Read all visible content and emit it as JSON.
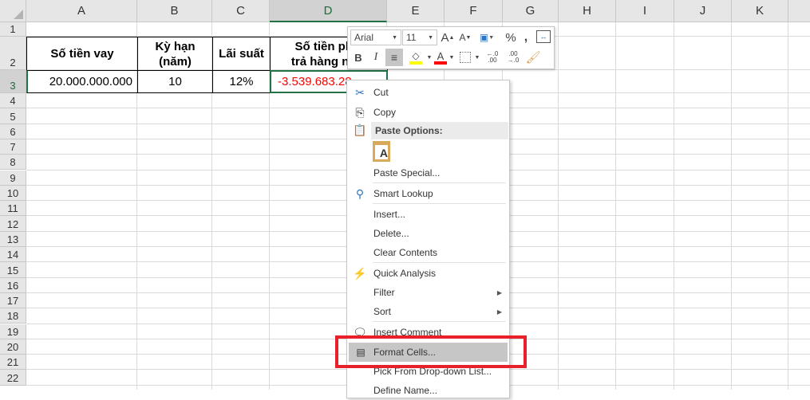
{
  "columns": [
    "A",
    "B",
    "C",
    "D",
    "E",
    "F",
    "G",
    "H",
    "I",
    "J",
    "K"
  ],
  "rows": [
    "1",
    "2",
    "3",
    "4",
    "5",
    "6",
    "7",
    "8",
    "9",
    "10",
    "11",
    "12",
    "13",
    "14",
    "15",
    "16",
    "17",
    "18",
    "19",
    "20",
    "21",
    "22"
  ],
  "headers": {
    "a": "Số tiền vay",
    "b": "Kỳ hạn (năm)",
    "c": "Lãi suất",
    "d": "Số tiền phải trả hàng năm"
  },
  "values": {
    "a": "20.000.000.000",
    "b": "10",
    "c": "12%",
    "d": "-3.539.683.28"
  },
  "toolbar": {
    "font": "Arial",
    "size": "11",
    "bold": "B",
    "italic": "I",
    "percent": "%",
    "comma": ",",
    "inc_dec": "←.0 .00",
    "dec_dec": ".00 →.0"
  },
  "menu": {
    "cut": "Cut",
    "copy": "Copy",
    "paste_options": "Paste Options:",
    "paste_special": "Paste Special...",
    "smart_lookup": "Smart Lookup",
    "insert": "Insert...",
    "delete": "Delete...",
    "clear": "Clear Contents",
    "quick_analysis": "Quick Analysis",
    "filter": "Filter",
    "sort": "Sort",
    "insert_comment": "Insert Comment",
    "format_cells": "Format Cells...",
    "pick": "Pick From Drop-down List...",
    "define_name": "Define Name..."
  },
  "colors": {
    "accent": "#217346",
    "negative": "#ff0000",
    "highlight": "#e8202a"
  }
}
